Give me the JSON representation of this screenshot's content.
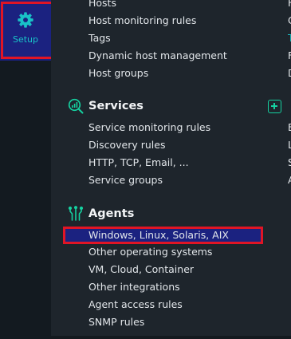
{
  "sidebar": {
    "setup_label": "Setup",
    "setup_icon": "gear-icon"
  },
  "hosts": {
    "items": [
      "Hosts",
      "Host monitoring rules",
      "Tags",
      "Dynamic host management",
      "Host groups"
    ]
  },
  "services": {
    "title": "Services",
    "icon": "services-icon",
    "items": [
      "Service monitoring rules",
      "Discovery rules",
      "HTTP, TCP, Email, ...",
      "Service groups"
    ]
  },
  "agents": {
    "title": "Agents",
    "icon": "agents-icon",
    "items": [
      "Windows, Linux, Solaris, AIX",
      "Other operating systems",
      "VM, Cloud, Container",
      "Other integrations",
      "Agent access rules",
      "SNMP rules"
    ]
  },
  "colors": {
    "accent": "#15d1a0",
    "highlight": "#1b2280",
    "annotation": "#e01525"
  }
}
